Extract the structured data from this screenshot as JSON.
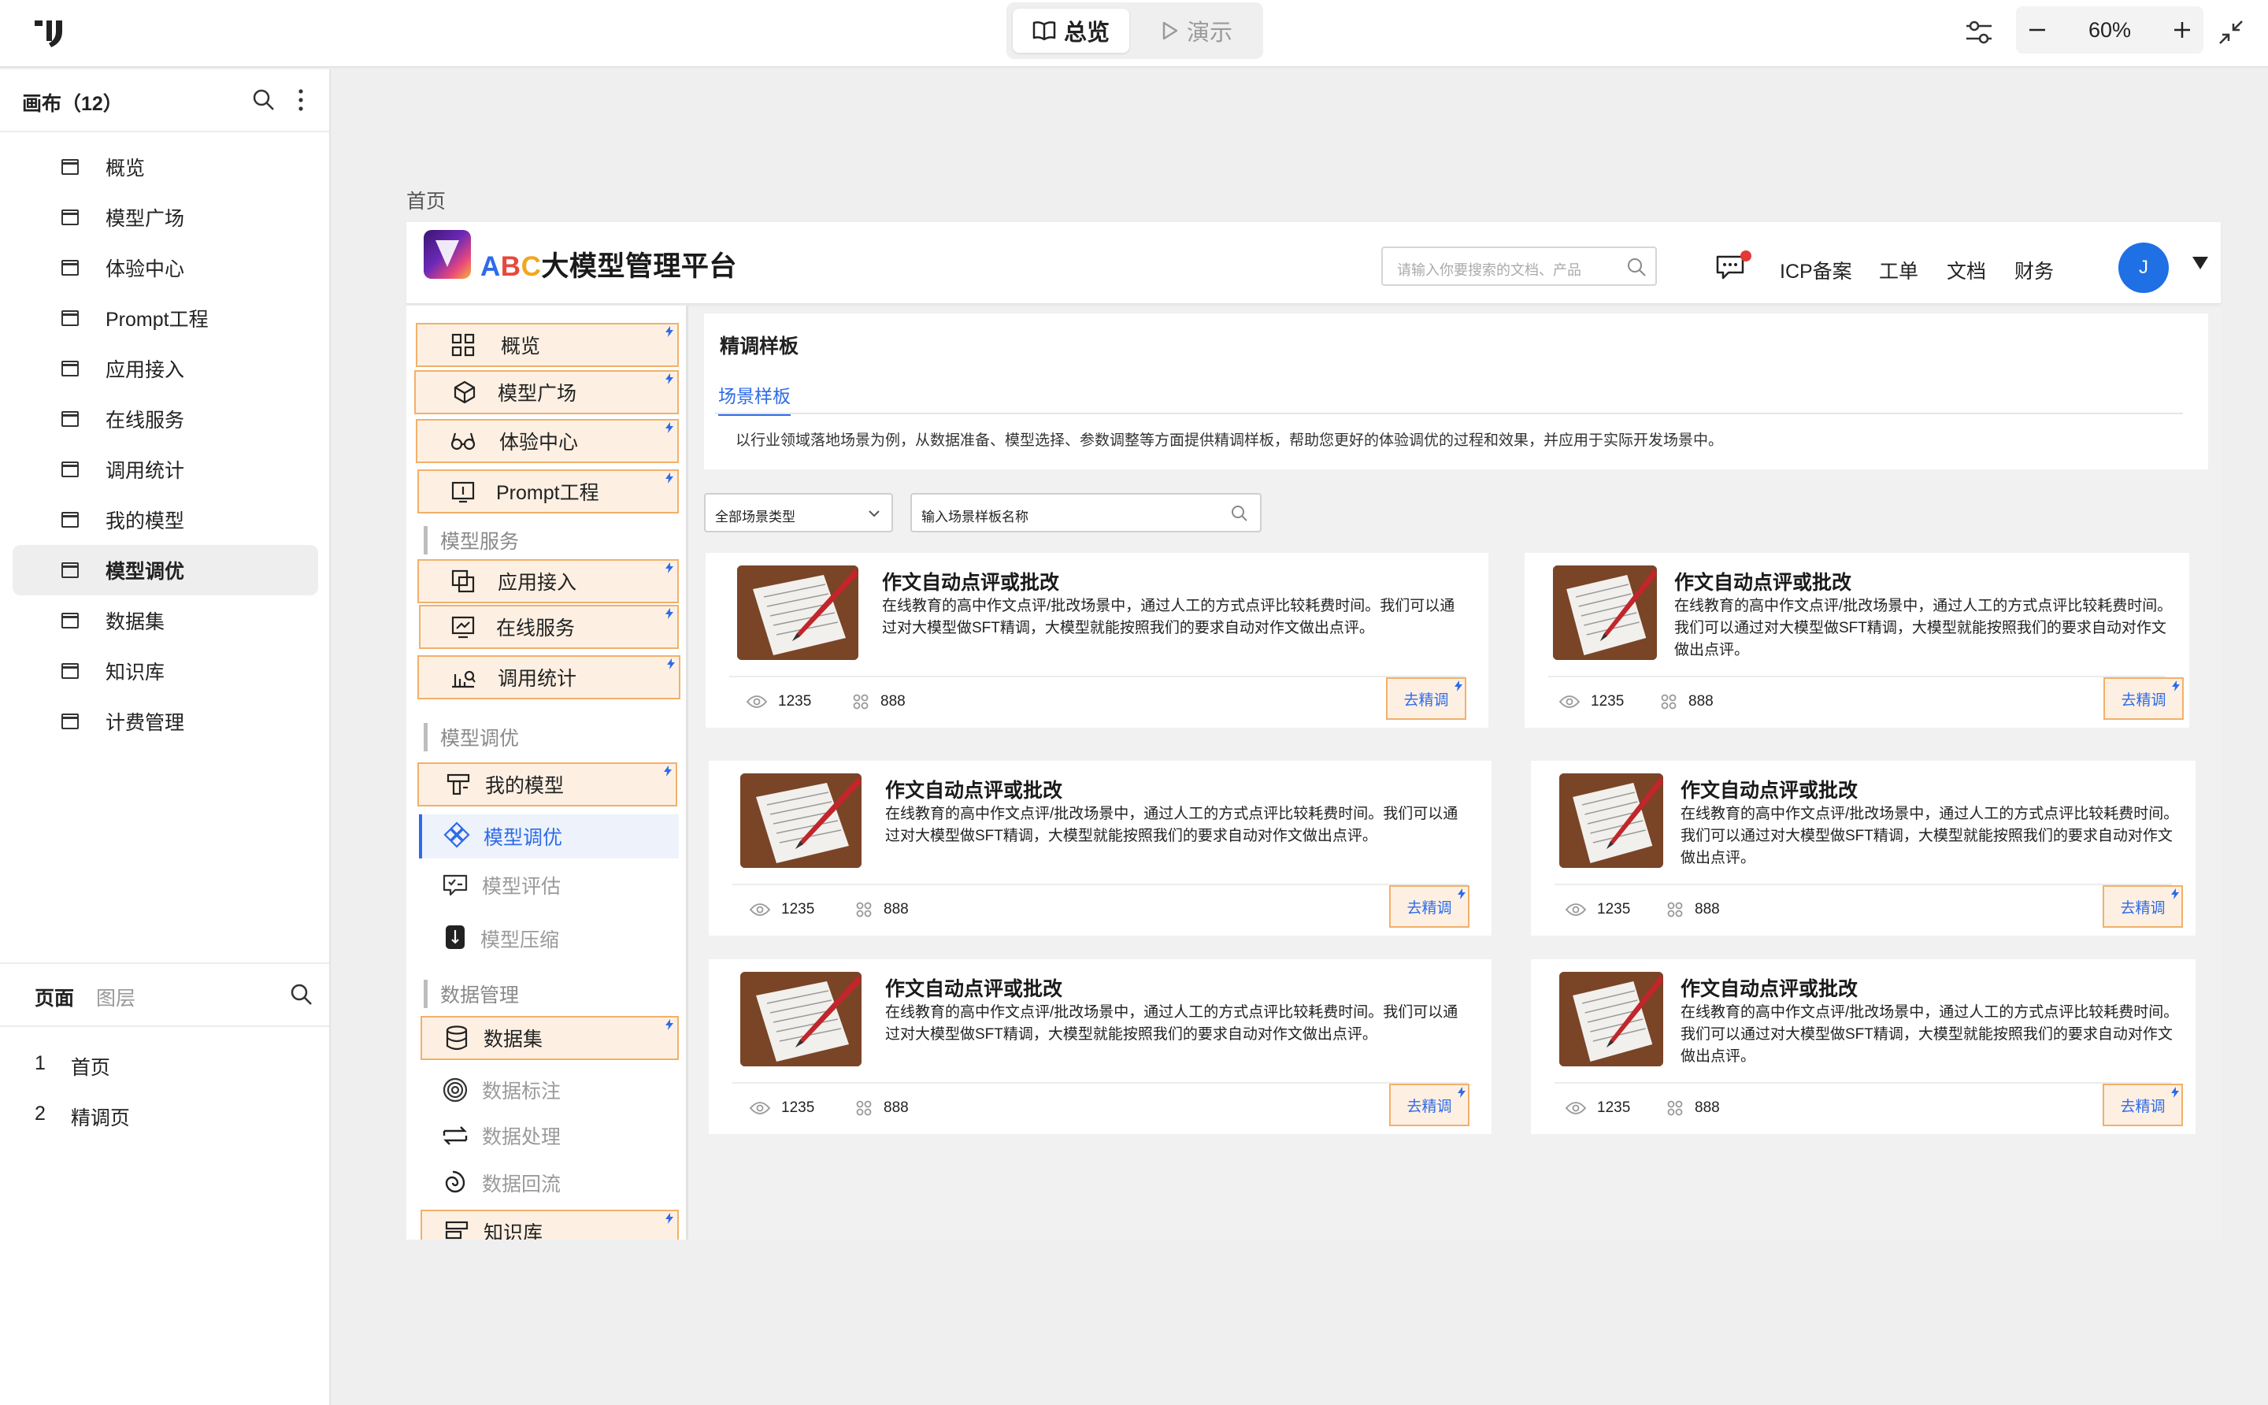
{
  "toolbar": {
    "overview_label": "总览",
    "present_label": "演示",
    "zoom_value": "60%"
  },
  "left_panel": {
    "title": "画布（12）",
    "canvas_items": [
      {
        "label": "概览"
      },
      {
        "label": "模型广场"
      },
      {
        "label": "体验中心"
      },
      {
        "label": "Prompt工程"
      },
      {
        "label": "应用接入"
      },
      {
        "label": "在线服务"
      },
      {
        "label": "调用统计"
      },
      {
        "label": "我的模型"
      },
      {
        "label": "模型调优",
        "selected": true
      },
      {
        "label": "数据集"
      },
      {
        "label": "知识库"
      },
      {
        "label": "计费管理"
      }
    ],
    "bottom_tabs": {
      "pages": "页面",
      "layers": "图层"
    },
    "pages": [
      {
        "num": "1",
        "label": "首页"
      },
      {
        "num": "2",
        "label": "精调页"
      }
    ]
  },
  "frame": {
    "label": "首页",
    "header": {
      "title_a": "A",
      "title_b": "B",
      "title_c": "C",
      "title_rest": "大模型管理平台",
      "search_placeholder": "请输入你要搜索的文档、产品",
      "nav": [
        "ICP备案",
        "工单",
        "文档",
        "财务"
      ],
      "avatar_letter": "J"
    },
    "sidebar": {
      "items": [
        {
          "label": "概览",
          "icon": "grid-icon"
        },
        {
          "label": "模型广场",
          "icon": "cube-icon"
        },
        {
          "label": "体验中心",
          "icon": "glasses-icon"
        },
        {
          "label": "Prompt工程",
          "icon": "prompt-icon"
        },
        {
          "label": "应用接入",
          "icon": "app-access-icon"
        },
        {
          "label": "在线服务",
          "icon": "online-service-icon"
        },
        {
          "label": "调用统计",
          "icon": "stats-icon"
        },
        {
          "label": "我的模型",
          "icon": "my-model-icon"
        },
        {
          "label": "模型调优",
          "icon": "tuning-icon",
          "active": true
        },
        {
          "label": "模型评估",
          "icon": "eval-icon"
        },
        {
          "label": "模型压缩",
          "icon": "compress-icon"
        },
        {
          "label": "数据集",
          "icon": "database-icon"
        },
        {
          "label": "数据标注",
          "icon": "annotate-icon"
        },
        {
          "label": "数据处理",
          "icon": "process-icon"
        },
        {
          "label": "数据回流",
          "icon": "reflow-icon"
        },
        {
          "label": "知识库",
          "icon": "knowledge-icon"
        }
      ],
      "sections": {
        "model_service": "模型服务",
        "model_tuning": "模型调优",
        "data_mgmt": "数据管理"
      }
    },
    "content": {
      "title": "精调样板",
      "tab": "场景样板",
      "description": "以行业领域落地场景为例，从数据准备、模型选择、参数调整等方面提供精调样板，帮助您更好的体验调优的过程和效果，并应用于实际开发场景中。",
      "filter_select": "全部场景类型",
      "filter_input": "输入场景样板名称",
      "cards": [
        {
          "title": "作文自动点评或批改",
          "desc": "在线教育的高中作文点评/批改场景中，通过人工的方式点评比较耗费时间。我们可以通过对大模型做SFT精调，大模型就能按照我们的要求自动对作文做出点评。",
          "views": "1235",
          "uses": "888",
          "button": "去精调"
        },
        {
          "title": "作文自动点评或批改",
          "desc": "在线教育的高中作文点评/批改场景中，通过人工的方式点评比较耗费时间。我们可以通过对大模型做SFT精调，大模型就能按照我们的要求自动对作文做出点评。",
          "views": "1235",
          "uses": "888",
          "button": "去精调"
        },
        {
          "title": "作文自动点评或批改",
          "desc": "在线教育的高中作文点评/批改场景中，通过人工的方式点评比较耗费时间。我们可以通过对大模型做SFT精调，大模型就能按照我们的要求自动对作文做出点评。",
          "views": "1235",
          "uses": "888",
          "button": "去精调"
        },
        {
          "title": "作文自动点评或批改",
          "desc": "在线教育的高中作文点评/批改场景中，通过人工的方式点评比较耗费时间。我们可以通过对大模型做SFT精调，大模型就能按照我们的要求自动对作文做出点评。",
          "views": "1235",
          "uses": "888",
          "button": "去精调"
        },
        {
          "title": "作文自动点评或批改",
          "desc": "在线教育的高中作文点评/批改场景中，通过人工的方式点评比较耗费时间。我们可以通过对大模型做SFT精调，大模型就能按照我们的要求自动对作文做出点评。",
          "views": "1235",
          "uses": "888",
          "button": "去精调"
        },
        {
          "title": "作文自动点评或批改",
          "desc": "在线教育的高中作文点评/批改场景中，通过人工的方式点评比较耗费时间。我们可以通过对大模型做SFT精调，大模型就能按照我们的要求自动对作文做出点评。",
          "views": "1235",
          "uses": "888",
          "button": "去精调"
        }
      ]
    }
  },
  "colors": {
    "accent": "#2f6be8",
    "highlight_fill": "#fdf0e3",
    "highlight_border": "#f2b06a",
    "notify": "#e53935"
  }
}
